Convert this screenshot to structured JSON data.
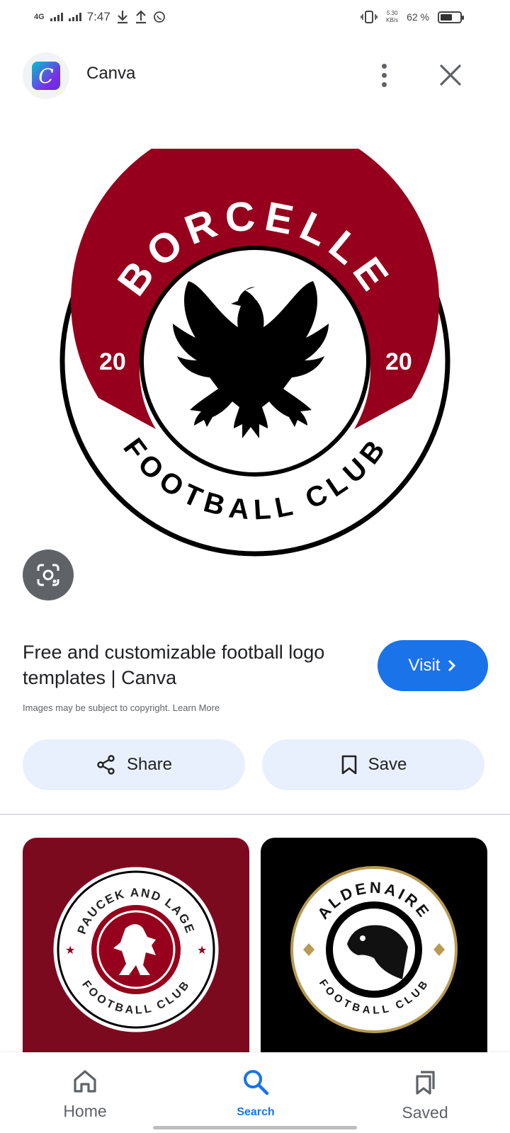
{
  "status_bar": {
    "network": "4G",
    "time": "7:47",
    "speed_value": "5.30",
    "speed_unit": "KB/s",
    "battery_text": "62 %",
    "battery_level": 0.62
  },
  "header": {
    "app_icon_letter": "C",
    "app_name": "Canva"
  },
  "main_image": {
    "top_text": "BORCELLE",
    "bottom_text": "FOOTBALL CLUB",
    "year_left": "20",
    "year_right": "20",
    "accent_color": "#96001c"
  },
  "result": {
    "title": "Free and customizable football logo templates | Canva",
    "visit_label": "Visit",
    "copyright_text": "Images may be subject to copyright.",
    "learn_more": "Learn More"
  },
  "actions": {
    "share_label": "Share",
    "save_label": "Save"
  },
  "related": [
    {
      "top_text": "PAUCEK AND LAGE",
      "bottom_text": "FOOTBALL CLUB"
    },
    {
      "top_text": "ALDENAIRE",
      "bottom_text": "FOOTBALL CLUB"
    }
  ],
  "bottom_nav": {
    "home": "Home",
    "search": "Search",
    "saved": "Saved"
  },
  "colors": {
    "primary_blue": "#1a73e8",
    "chip_bg": "#e8f0fe",
    "crest_red": "#96001c"
  }
}
